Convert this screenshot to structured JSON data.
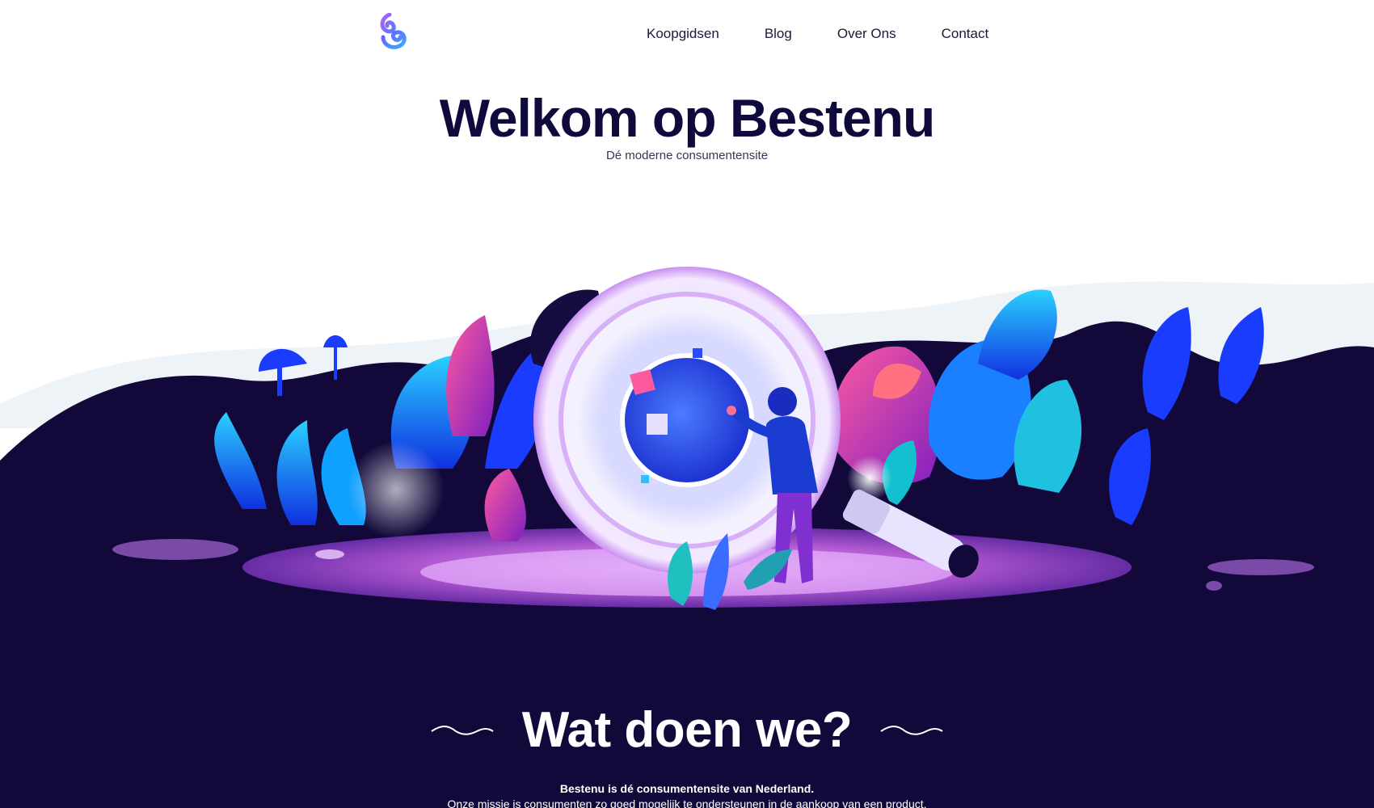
{
  "nav": {
    "items": [
      {
        "label": "Koopgidsen"
      },
      {
        "label": "Blog"
      },
      {
        "label": "Over Ons"
      },
      {
        "label": "Contact"
      }
    ]
  },
  "hero": {
    "title": "Welkom op Bestenu",
    "subtitle": "Dé moderne consumentensite"
  },
  "about": {
    "title": "Wat doen we?",
    "intro": "Bestenu is dé consumentensite van Nederland.",
    "text": "Onze missie is consumenten zo goed mogelijk te ondersteunen in de aankoop van een product."
  },
  "colors": {
    "brand_dark": "#12093a",
    "title": "#0f0a3c",
    "accent_blue": "#1a3cff",
    "accent_purple": "#a040e0",
    "accent_pink": "#d040a0"
  },
  "icons": {
    "logo": "bestenu-logo-icon",
    "wave": "wave-decoration-icon"
  }
}
